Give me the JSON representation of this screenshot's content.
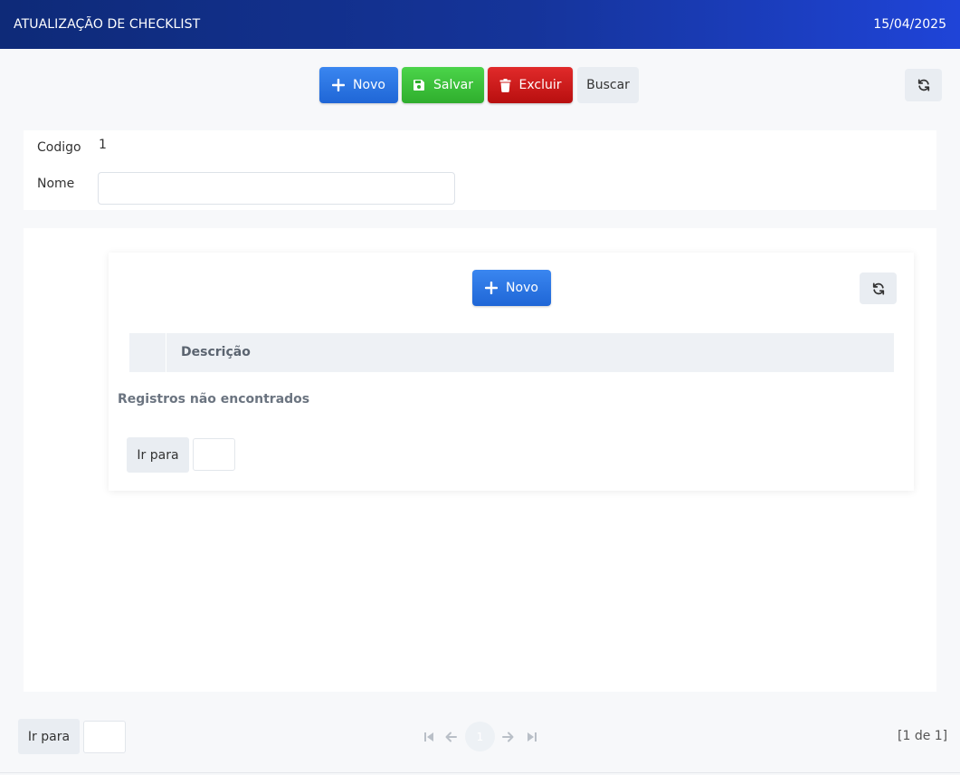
{
  "header": {
    "title": "ATUALIZAÇÃO DE CHECKLIST",
    "date": "15/04/2025"
  },
  "toolbar": {
    "new_label": "Novo",
    "save_label": "Salvar",
    "delete_label": "Excluir",
    "search_label": "Buscar"
  },
  "form": {
    "code_label": "Codigo",
    "code_value": "1",
    "name_label": "Nome",
    "name_value": ""
  },
  "items": {
    "new_label": "Novo",
    "columns": [
      "",
      "Descrição"
    ],
    "empty_message": "Registros não encontrados",
    "goto_label": "Ir para",
    "goto_value": ""
  },
  "footer": {
    "goto_label": "Ir para",
    "goto_value": "",
    "current_page": "1",
    "page_info": "[1 de 1]"
  },
  "colors": {
    "primary": "#1f66d6",
    "success": "#2fae2d",
    "danger": "#b80f0f",
    "header": "#15349a"
  },
  "icons": [
    "plus-icon",
    "save-icon",
    "trash-icon",
    "refresh-icon",
    "first-page-icon",
    "prev-page-icon",
    "next-page-icon",
    "last-page-icon"
  ]
}
